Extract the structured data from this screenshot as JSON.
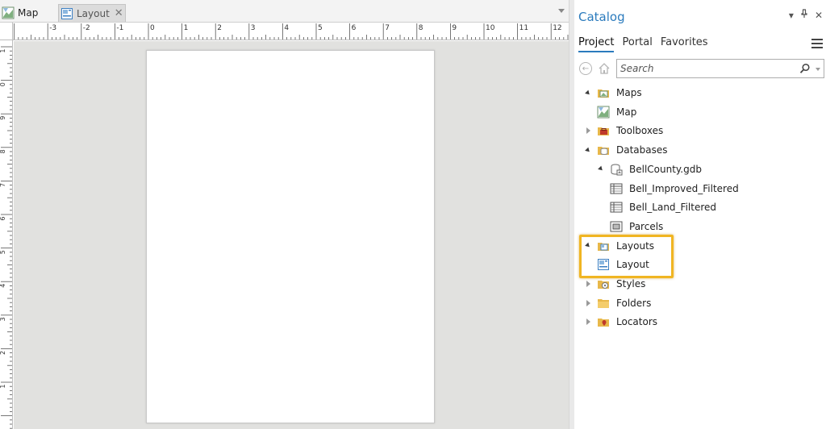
{
  "tabs": [
    {
      "label": "Map",
      "active": false
    },
    {
      "label": "Layout",
      "active": true,
      "closable": true
    }
  ],
  "ruler": {
    "top_labels": [
      "-3",
      "-2",
      "-1",
      "0",
      "1",
      "2",
      "3",
      "4",
      "5",
      "6",
      "7",
      "8",
      "9",
      "10",
      "11",
      "12"
    ],
    "left_labels": [
      "1",
      "0",
      "9",
      "8",
      "7",
      "6",
      "5",
      "4",
      "3",
      "2",
      "1"
    ]
  },
  "catalog": {
    "title": "Catalog",
    "controls": {
      "dropdown": "▾",
      "pin": "pin-icon",
      "close": "✕"
    },
    "tabs": [
      "Project",
      "Portal",
      "Favorites"
    ],
    "active_tab": "Project",
    "search": {
      "placeholder": "Search",
      "value": ""
    },
    "tree": [
      {
        "label": "Maps",
        "icon": "maps-folder-icon",
        "expanded": true,
        "depth": 0
      },
      {
        "label": "Map",
        "icon": "map-icon",
        "depth": 1
      },
      {
        "label": "Toolboxes",
        "icon": "toolboxes-folder-icon",
        "expanded": false,
        "depth": 0
      },
      {
        "label": "Databases",
        "icon": "databases-folder-icon",
        "expanded": true,
        "depth": 0
      },
      {
        "label": "BellCounty.gdb",
        "icon": "geodatabase-icon",
        "expanded": true,
        "depth": 1
      },
      {
        "label": "Bell_Improved_Filtered",
        "icon": "table-icon",
        "depth": 2
      },
      {
        "label": "Bell_Land_Filtered",
        "icon": "table-icon",
        "depth": 2
      },
      {
        "label": "Parcels",
        "icon": "feature-class-icon",
        "depth": 2
      },
      {
        "label": "Layouts",
        "icon": "layouts-folder-icon",
        "expanded": true,
        "depth": 0
      },
      {
        "label": "Layout",
        "icon": "layout-icon",
        "depth": 1
      },
      {
        "label": "Styles",
        "icon": "styles-folder-icon",
        "expanded": false,
        "depth": 0
      },
      {
        "label": "Folders",
        "icon": "folders-folder-icon",
        "expanded": false,
        "depth": 0
      },
      {
        "label": "Locators",
        "icon": "locators-folder-icon",
        "expanded": false,
        "depth": 0
      }
    ]
  },
  "colors": {
    "accent": "#2b7bbd",
    "highlight": "#f0b522",
    "canvas": "#e1e1df",
    "folder": "#e8b84a"
  }
}
